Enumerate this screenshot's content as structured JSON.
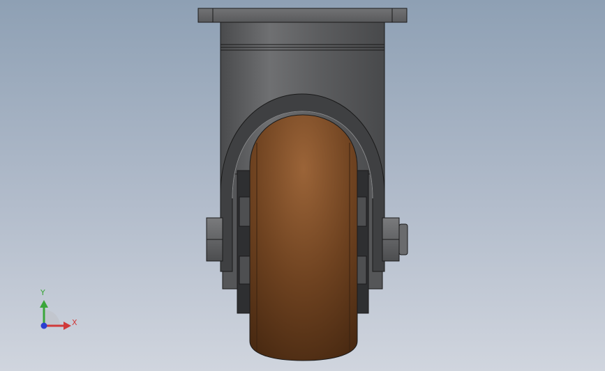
{
  "triad": {
    "y_label": "Y",
    "x_label": "X",
    "colors": {
      "x": "#d03a3a",
      "y": "#3aa63a",
      "z": "#2b3fd0"
    }
  },
  "model": {
    "parts": [
      "top-plate",
      "swivel-housing",
      "fork",
      "axle-bolt",
      "axle-nut",
      "wheel-hub",
      "wheel-tread"
    ],
    "colors": {
      "metal": "#5d5e60",
      "tread": "#8a5530",
      "background_top": "#8ea0b4",
      "background_bottom": "#d0d5de"
    }
  }
}
